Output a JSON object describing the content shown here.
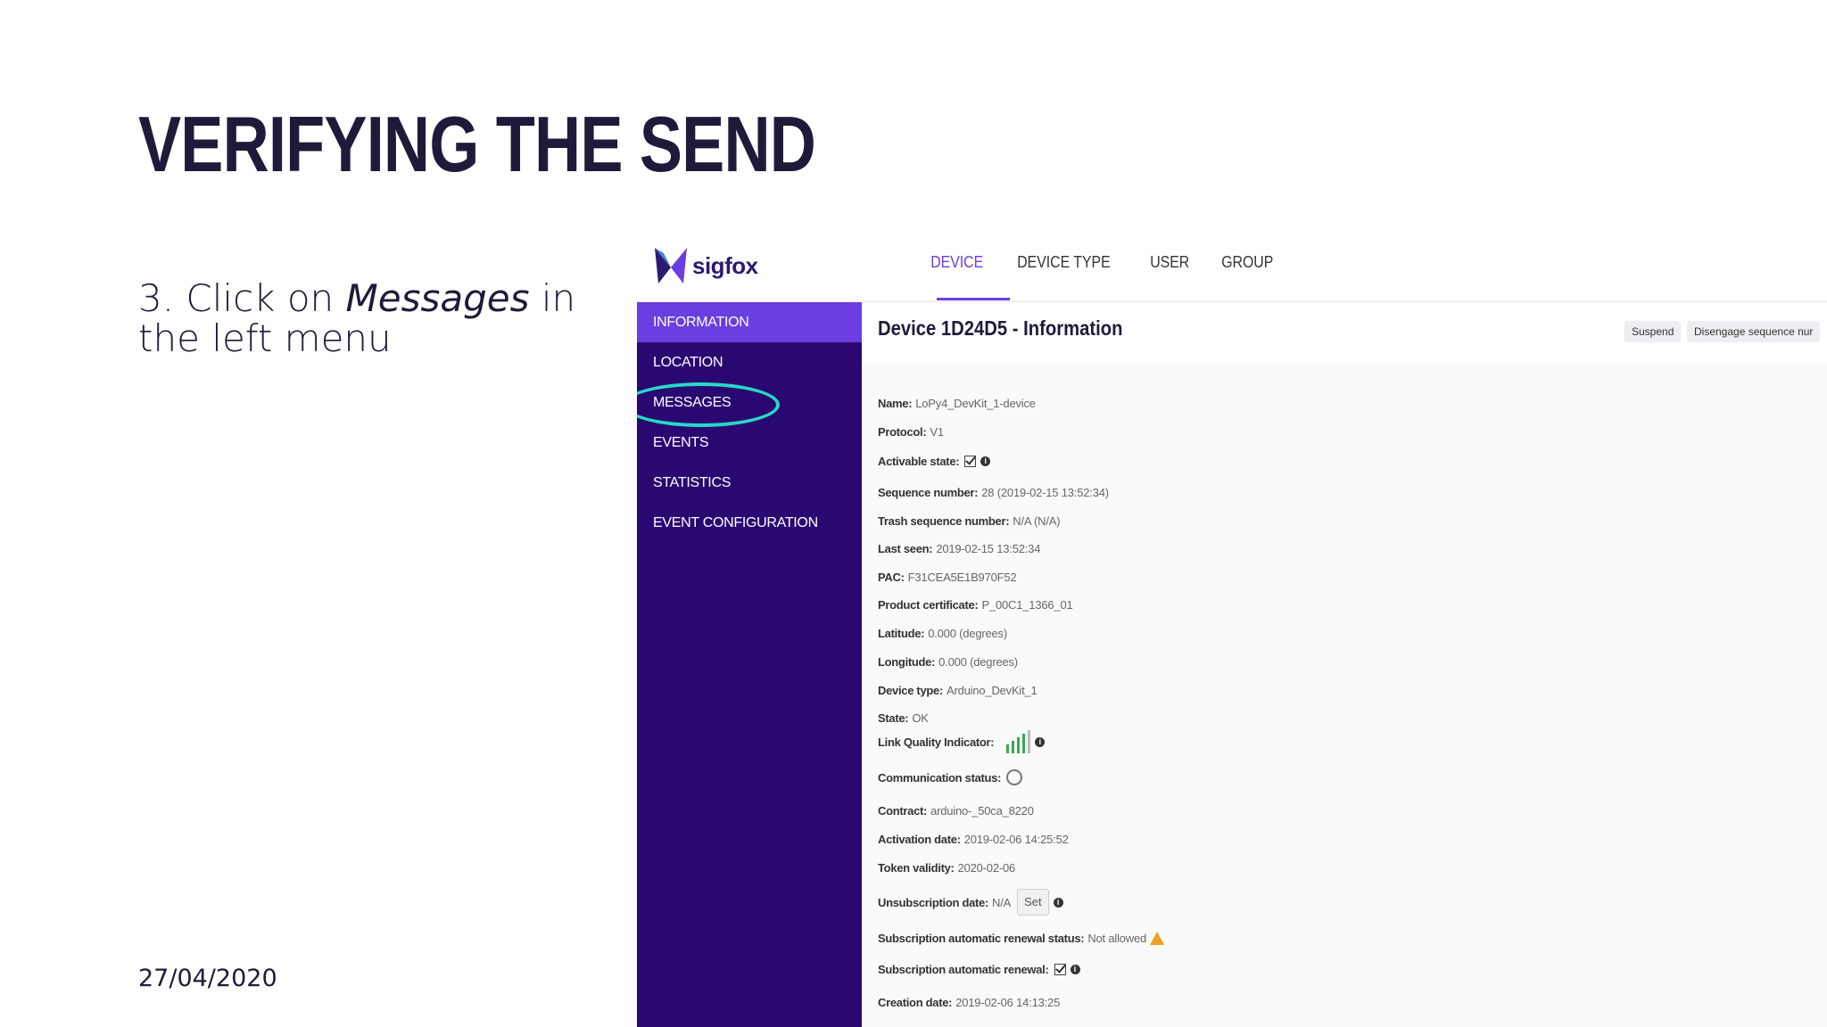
{
  "slide": {
    "title": "Verifying the send",
    "instruction_prefix": "3. Click on ",
    "instruction_emphasis": "Messages",
    "instruction_suffix": " in the left menu",
    "date": "27/04/2020"
  },
  "app": {
    "logo_text": "sigfox",
    "nav": [
      "DEVICE",
      "DEVICE TYPE",
      "USER",
      "GROUP"
    ],
    "sidebar": [
      "INFORMATION",
      "LOCATION",
      "MESSAGES",
      "EVENTS",
      "STATISTICS",
      "EVENT CONFIGURATION"
    ],
    "page_title": "Device 1D24D5 - Information",
    "buttons": {
      "suspend": "Suspend",
      "disengage": "Disengage sequence nur"
    },
    "fields": [
      {
        "label": "Name:",
        "value": "LoPy4_DevKit_1-device"
      },
      {
        "label": "Protocol:",
        "value": "V1"
      },
      {
        "label": "Activable state:",
        "value": ""
      },
      {
        "label": "Sequence number:",
        "value": "28 (2019-02-15 13:52:34)"
      },
      {
        "label": "Trash sequence number:",
        "value": "N/A (N/A)"
      },
      {
        "label": "Last seen:",
        "value": "2019-02-15 13:52:34"
      },
      {
        "label": "PAC:",
        "value": "F31CEA5E1B970F52"
      },
      {
        "label": "Product certificate:",
        "value": "P_00C1_1366_01"
      },
      {
        "label": "Latitude:",
        "value": "0.000 (degrees)"
      },
      {
        "label": "Longitude:",
        "value": "0.000 (degrees)"
      },
      {
        "label": "Device type:",
        "value": "Arduino_DevKit_1"
      },
      {
        "label": "State:",
        "value": "OK"
      },
      {
        "label": "Link Quality Indicator:",
        "value": ""
      },
      {
        "label": "Communication status:",
        "value": ""
      },
      {
        "label": "Contract:",
        "value": "arduino-_50ca_8220"
      },
      {
        "label": "Activation date:",
        "value": "2019-02-06 14:25:52"
      },
      {
        "label": "Token validity:",
        "value": "2020-02-06"
      },
      {
        "label": "Unsubscription date:",
        "value": "N/A"
      },
      {
        "label": "Subscription automatic renewal status:",
        "value": "Not allowed"
      },
      {
        "label": "Subscription automatic renewal:",
        "value": ""
      },
      {
        "label": "Creation date:",
        "value": "2019-02-06 14:13:25"
      }
    ],
    "set_label": "Set",
    "colors": {
      "sidebar": "#2a0872",
      "accent": "#6a3ee0",
      "highlight": "#27d9c6"
    },
    "icons": {
      "checkbox": "checked-checkbox-icon",
      "info": "info-icon",
      "signal": "signal-bars-icon",
      "status": "status-ring-icon",
      "warning": "warning-icon"
    }
  }
}
